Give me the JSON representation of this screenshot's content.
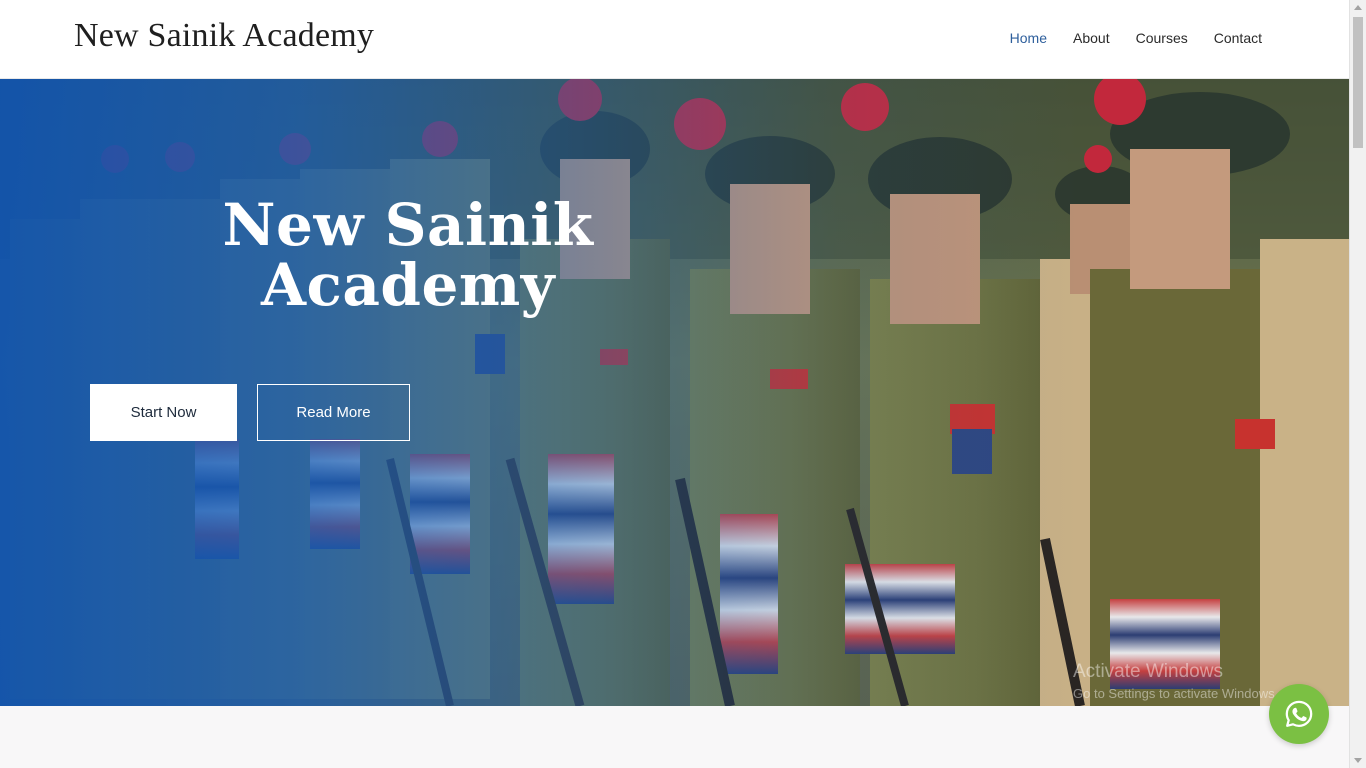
{
  "header": {
    "brand": "New Sainik Academy",
    "nav": [
      {
        "label": "Home",
        "active": true
      },
      {
        "label": "About",
        "active": false
      },
      {
        "label": "Courses",
        "active": false
      },
      {
        "label": "Contact",
        "active": false
      }
    ]
  },
  "hero": {
    "title_line1": "New Sainik",
    "title_line2": "Academy",
    "start_button": "Start Now",
    "read_button": "Read More"
  },
  "watermark": {
    "line1": "Activate Windows",
    "line2": "Go to Settings to activate Windows."
  },
  "icons": {
    "whatsapp": "whatsapp-icon"
  },
  "colors": {
    "nav_active": "#2e5f9c",
    "overlay_blue": "#0f54b2",
    "whatsapp_green": "#7bc043"
  }
}
